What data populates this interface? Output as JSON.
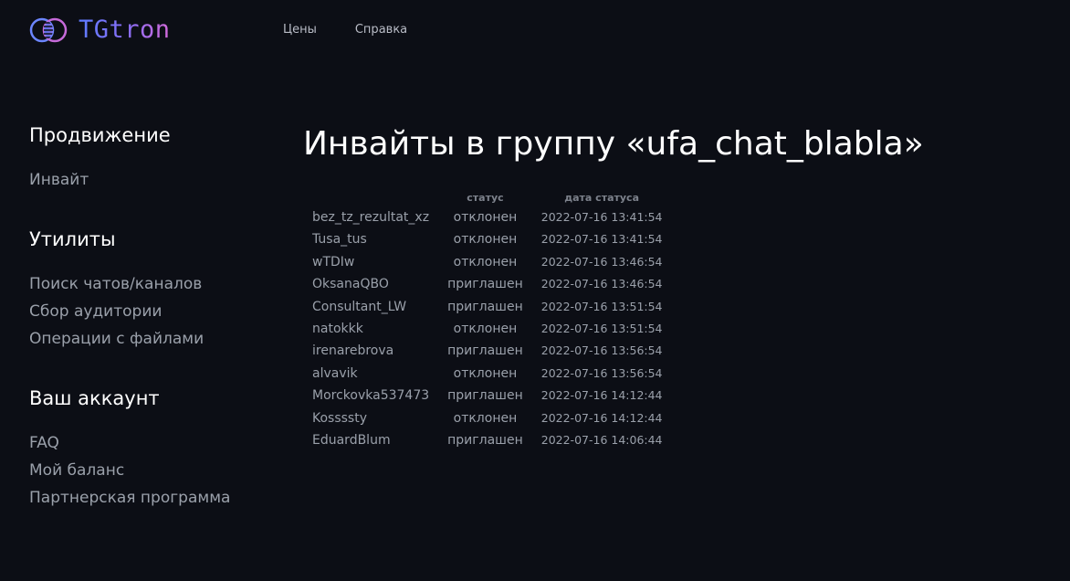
{
  "brand": {
    "name": "TGtron",
    "accent_start": "#5d7bff",
    "accent_end": "#d46ad9"
  },
  "nav": {
    "items": [
      {
        "label": "Цены"
      },
      {
        "label": "Справка"
      }
    ]
  },
  "sidebar": {
    "groups": [
      {
        "heading": "Продвижение",
        "items": [
          {
            "label": "Инвайт"
          }
        ]
      },
      {
        "heading": "Утилиты",
        "items": [
          {
            "label": "Поиск чатов/каналов"
          },
          {
            "label": "Сбор аудитории"
          },
          {
            "label": "Операции с файлами"
          }
        ]
      },
      {
        "heading": "Ваш аккаунт",
        "items": [
          {
            "label": "FAQ"
          },
          {
            "label": "Мой баланс"
          },
          {
            "label": "Партнерская программа"
          }
        ]
      }
    ]
  },
  "main": {
    "title": "Инвайты в группу «ufa_chat_blabla»",
    "table": {
      "columns": [
        "",
        "статус",
        "дата статуса"
      ],
      "rows": [
        {
          "user": "bez_tz_rezultat_xz",
          "status": "отклонен",
          "date": "2022-07-16 13:41:54"
        },
        {
          "user": "Tusa_tus",
          "status": "отклонен",
          "date": "2022-07-16 13:41:54"
        },
        {
          "user": "wTDIw",
          "status": "отклонен",
          "date": "2022-07-16 13:46:54"
        },
        {
          "user": "OksanaQBO",
          "status": "приглашен",
          "date": "2022-07-16 13:46:54"
        },
        {
          "user": "Consultant_LW",
          "status": "приглашен",
          "date": "2022-07-16 13:51:54"
        },
        {
          "user": "natokkk",
          "status": "отклонен",
          "date": "2022-07-16 13:51:54"
        },
        {
          "user": "irenarebrova",
          "status": "приглашен",
          "date": "2022-07-16 13:56:54"
        },
        {
          "user": "alvavik",
          "status": "отклонен",
          "date": "2022-07-16 13:56:54"
        },
        {
          "user": "Morckovka537473",
          "status": "приглашен",
          "date": "2022-07-16 14:12:44"
        },
        {
          "user": "Kossssty",
          "status": "отклонен",
          "date": "2022-07-16 14:12:44"
        },
        {
          "user": "EduardBlum",
          "status": "приглашен",
          "date": "2022-07-16 14:06:44"
        }
      ]
    }
  }
}
